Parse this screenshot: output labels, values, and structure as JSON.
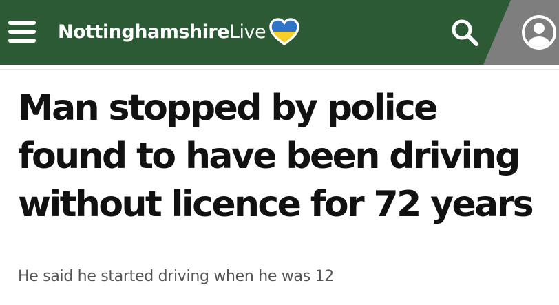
{
  "header": {
    "brand_bold": "Nottinghamshire",
    "brand_light": "Live",
    "icons": {
      "menu": "hamburger-menu-icon",
      "heart": "ukraine-heart-icon",
      "search": "search-icon",
      "account": "user-account-icon"
    },
    "colors": {
      "bar": "#2b5a34",
      "account_slab": "#7e7e7e",
      "heart_top": "#2f74c9",
      "heart_bottom": "#f5cf2a"
    }
  },
  "article": {
    "headline": "Man stopped by police found to have been driving without licence for 72 years",
    "standfirst": "He said he started driving when he was 12"
  }
}
